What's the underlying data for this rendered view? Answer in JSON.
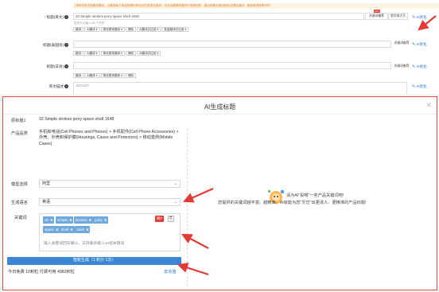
{
  "form": {
    "notice": "请填写英文标题并翻译，以确保每个商品标题均有对应的多语言版本；平台会根据标题进行搜索匹配，建议标题长度控制在合理范围内，避免使用特殊字符。",
    "title_en": {
      "label": "标题(英文)",
      "value": "32 Simple strokes pony space shell 1648",
      "hint": "您还可以输入 89 个字符",
      "buttons": [
        "翻译",
        "AI翻译 ▾",
        "简化繁体翻译 ▾",
        "删除",
        "AI翻译并应用 ▾",
        "批量翻译并应用 ▾"
      ],
      "side_buttons": [
        "关键词推荐",
        "首字母大写"
      ],
      "hot": "HOT",
      "ai": "AI优化"
    },
    "title_th": {
      "label": "标题(泰国语)",
      "value": "",
      "buttons": [
        "翻译",
        "AI翻译 ▾",
        "简化繁体翻译 ▾",
        "删除",
        "AI翻译并应用 ▾"
      ],
      "side_buttons": [
        "关键词推荐"
      ],
      "ai": "AI优化"
    },
    "title_ja": {
      "label": "标题(日语)",
      "value": "",
      "buttons": [
        "翻译",
        "AI翻译 ▾",
        "简化繁体翻译 ▾",
        "删除"
      ],
      "side_buttons": [
        "关键词推荐"
      ],
      "ai": "AI优化"
    },
    "desc": {
      "label": "英文描述",
      "value": "1670407",
      "ai": "AI优化"
    }
  },
  "modal": {
    "title": "AI生成标题",
    "original_title_label": "原标题1",
    "original_title_value": "32 Simple strokes pony space shell 1648",
    "category_label": "产品品类",
    "category_value": "手机和电话(Cell Phones and Phones) > 手机配件(Cell Phone Accessories) > 外壳、外壳和保护膜(Housings, Cases and Protectors) > 移动盒例(Mobile Cases)",
    "model_label": "模型选择",
    "model_value": "阿里",
    "lang_label": "生成语言",
    "lang_value": "英语",
    "keywords_label": "关键词",
    "keywords": [
      "32",
      "simple",
      "strokes",
      "pony",
      "space",
      "shell",
      "1648"
    ],
    "keywords_count": "剩7",
    "keywords_hint": "输入关键词回车确认，支持最多输入10组关键词",
    "generate_button": "智能生成（1 积分 1次）",
    "footer_text": "今日免费 10积粒 付费可用 4982积粒",
    "recharge_link": "去充值",
    "tip_line1": "请为AI\"投喂\"一些产品关键词吧!",
    "tip_line2": "您提供的关键词越丰富、越精准，AI就能为您\"烹饪\"出更诱人、更精准的产品标题!"
  },
  "colors": {
    "accent": "#3b87d6",
    "tag": "#6fa8dc",
    "arrow": "#e53935"
  }
}
